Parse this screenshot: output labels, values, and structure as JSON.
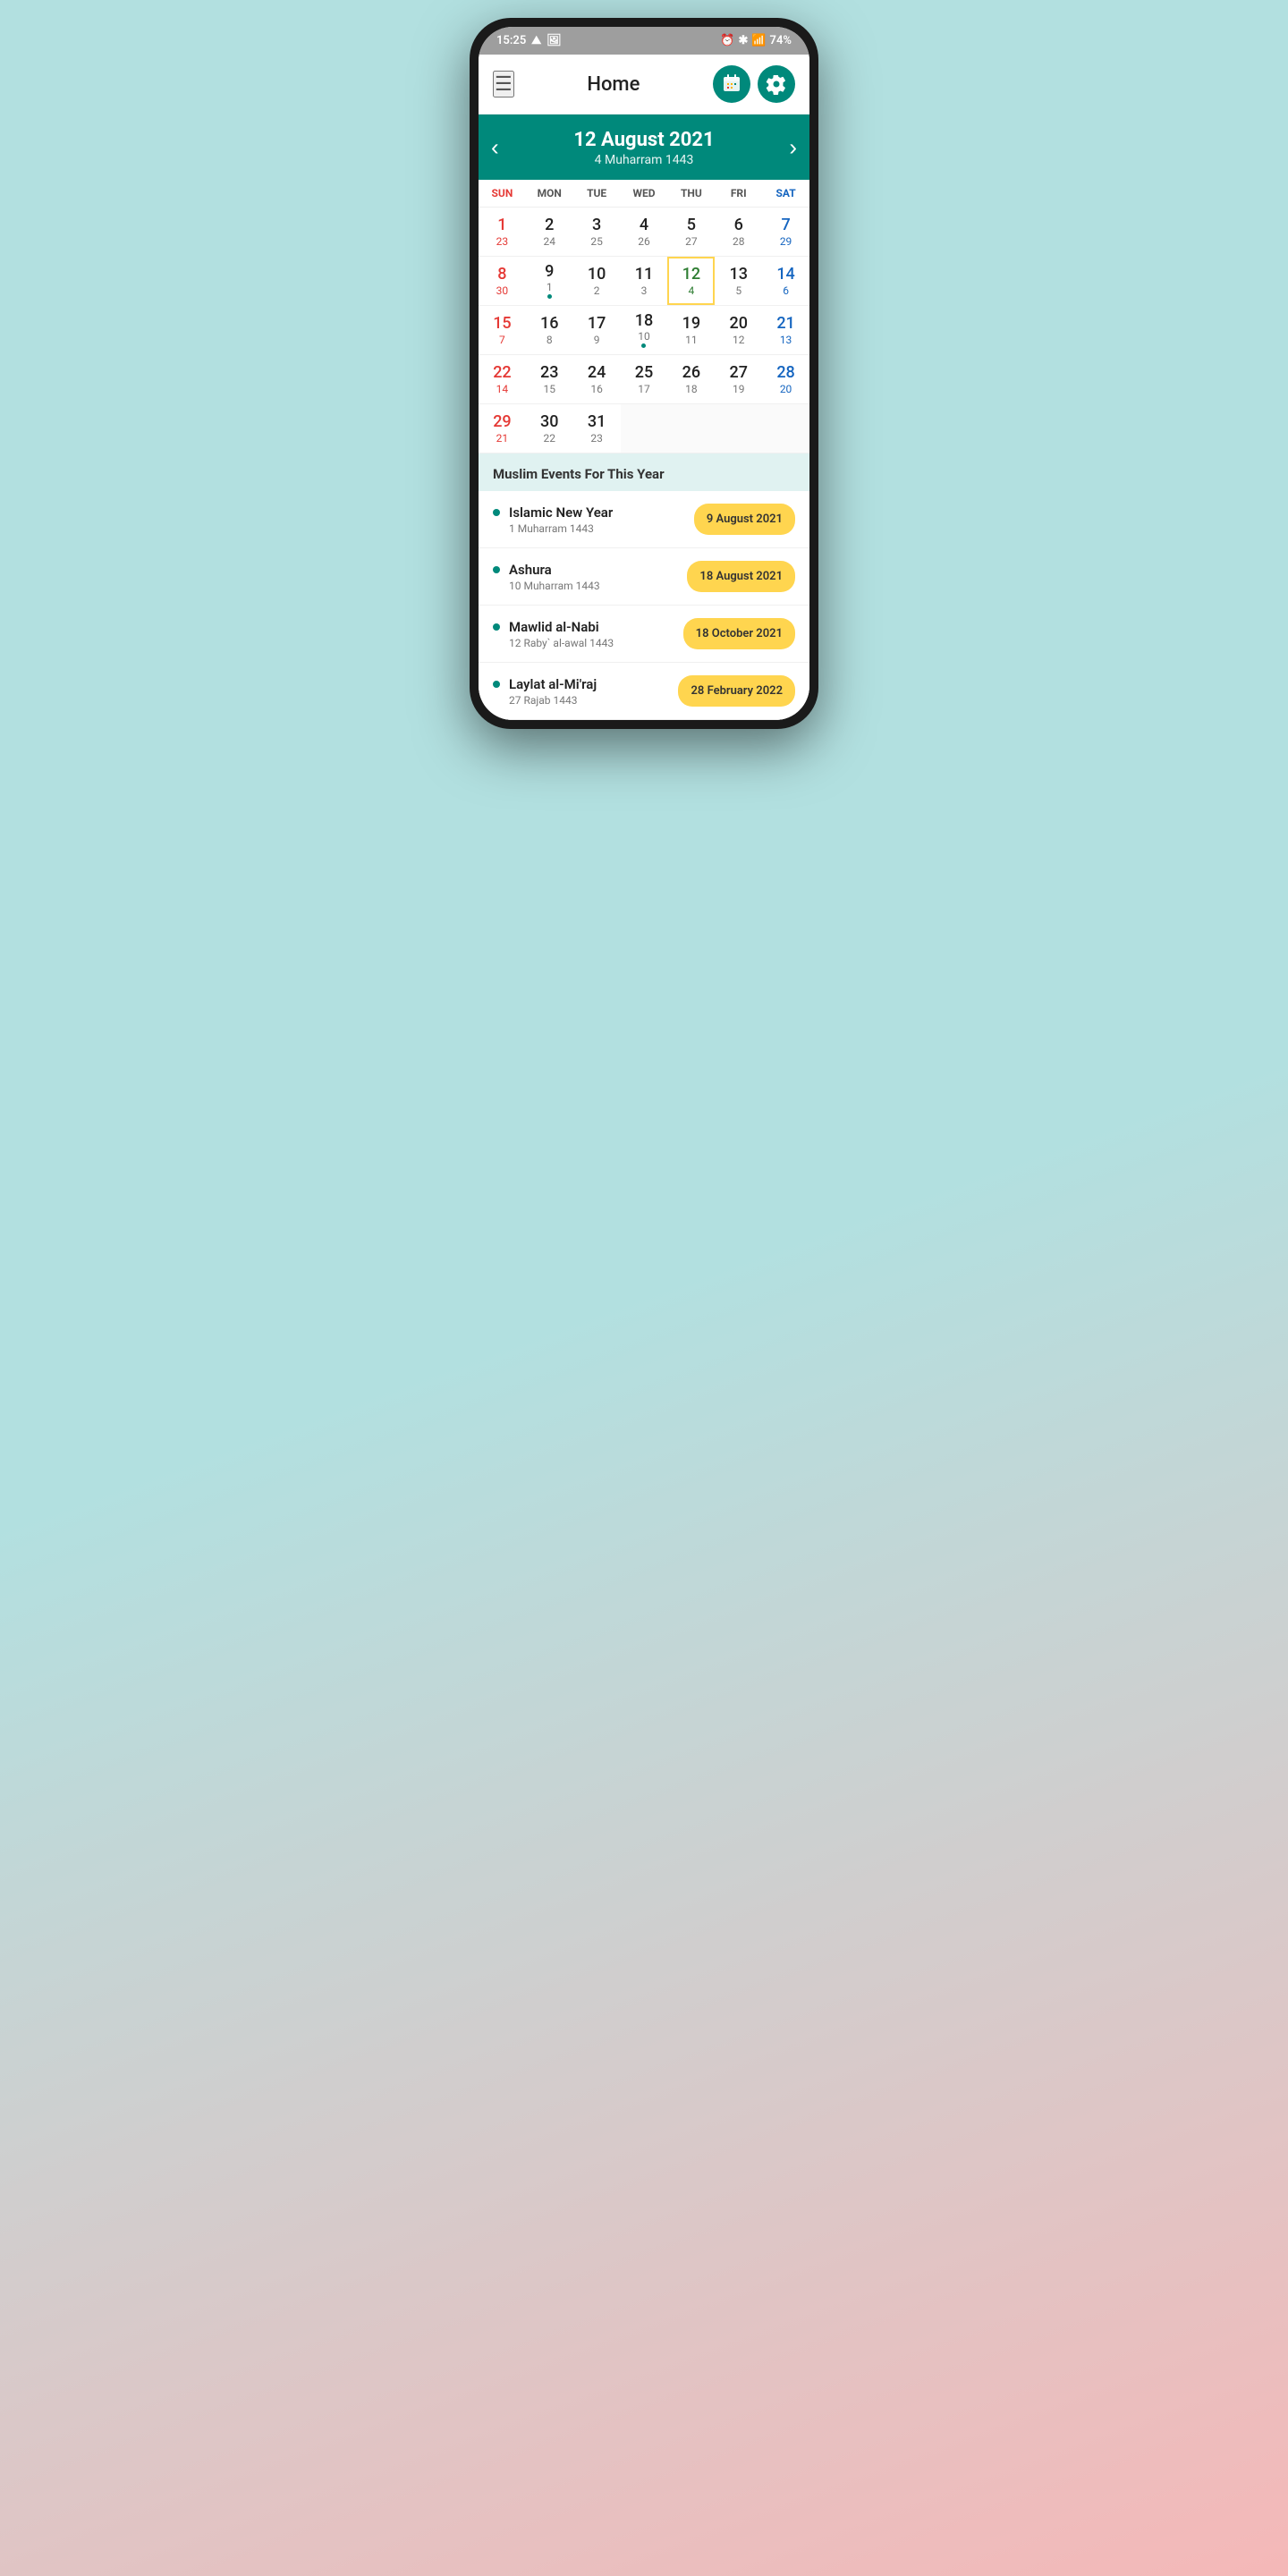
{
  "statusBar": {
    "time": "15:25",
    "battery": "74%"
  },
  "header": {
    "title": "Home"
  },
  "calendar": {
    "monthYear": "12 August 2021",
    "hijriDate": "4 Muharram 1443",
    "dayNames": [
      {
        "label": "SUN",
        "type": "sun"
      },
      {
        "label": "MON",
        "type": "weekday"
      },
      {
        "label": "TUE",
        "type": "weekday"
      },
      {
        "label": "WED",
        "type": "weekday"
      },
      {
        "label": "THU",
        "type": "weekday"
      },
      {
        "label": "FRI",
        "type": "weekday"
      },
      {
        "label": "SAT",
        "type": "sat"
      }
    ],
    "weeks": [
      [
        {
          "greg": "1",
          "hij": "23",
          "type": "sun-day",
          "today": false,
          "dot": false,
          "empty": false
        },
        {
          "greg": "2",
          "hij": "24",
          "type": "weekday-day",
          "today": false,
          "dot": false,
          "empty": false
        },
        {
          "greg": "3",
          "hij": "25",
          "type": "weekday-day",
          "today": false,
          "dot": false,
          "empty": false
        },
        {
          "greg": "4",
          "hij": "26",
          "type": "weekday-day",
          "today": false,
          "dot": false,
          "empty": false
        },
        {
          "greg": "5",
          "hij": "27",
          "type": "weekday-day",
          "today": false,
          "dot": false,
          "empty": false
        },
        {
          "greg": "6",
          "hij": "28",
          "type": "weekday-day",
          "today": false,
          "dot": false,
          "empty": false
        },
        {
          "greg": "7",
          "hij": "29",
          "type": "sat-day",
          "today": false,
          "dot": false,
          "empty": false
        }
      ],
      [
        {
          "greg": "8",
          "hij": "30",
          "type": "sun-day",
          "today": false,
          "dot": false,
          "empty": false
        },
        {
          "greg": "9",
          "hij": "1",
          "type": "weekday-day",
          "today": false,
          "dot": true,
          "empty": false
        },
        {
          "greg": "10",
          "hij": "2",
          "type": "weekday-day",
          "today": false,
          "dot": false,
          "empty": false
        },
        {
          "greg": "11",
          "hij": "3",
          "type": "weekday-day",
          "today": false,
          "dot": false,
          "empty": false
        },
        {
          "greg": "12",
          "hij": "4",
          "type": "weekday-day",
          "today": true,
          "dot": false,
          "empty": false
        },
        {
          "greg": "13",
          "hij": "5",
          "type": "weekday-day",
          "today": false,
          "dot": false,
          "empty": false
        },
        {
          "greg": "14",
          "hij": "6",
          "type": "sat-day",
          "today": false,
          "dot": false,
          "empty": false
        }
      ],
      [
        {
          "greg": "15",
          "hij": "7",
          "type": "sun-day",
          "today": false,
          "dot": false,
          "empty": false
        },
        {
          "greg": "16",
          "hij": "8",
          "type": "weekday-day",
          "today": false,
          "dot": false,
          "empty": false
        },
        {
          "greg": "17",
          "hij": "9",
          "type": "weekday-day",
          "today": false,
          "dot": false,
          "empty": false
        },
        {
          "greg": "18",
          "hij": "10",
          "type": "weekday-day",
          "today": false,
          "dot": true,
          "empty": false
        },
        {
          "greg": "19",
          "hij": "11",
          "type": "weekday-day",
          "today": false,
          "dot": false,
          "empty": false
        },
        {
          "greg": "20",
          "hij": "12",
          "type": "weekday-day",
          "today": false,
          "dot": false,
          "empty": false
        },
        {
          "greg": "21",
          "hij": "13",
          "type": "sat-day",
          "today": false,
          "dot": false,
          "empty": false
        }
      ],
      [
        {
          "greg": "22",
          "hij": "14",
          "type": "sun-day",
          "today": false,
          "dot": false,
          "empty": false
        },
        {
          "greg": "23",
          "hij": "15",
          "type": "weekday-day",
          "today": false,
          "dot": false,
          "empty": false
        },
        {
          "greg": "24",
          "hij": "16",
          "type": "weekday-day",
          "today": false,
          "dot": false,
          "empty": false
        },
        {
          "greg": "25",
          "hij": "17",
          "type": "weekday-day",
          "today": false,
          "dot": false,
          "empty": false
        },
        {
          "greg": "26",
          "hij": "18",
          "type": "weekday-day",
          "today": false,
          "dot": false,
          "empty": false
        },
        {
          "greg": "27",
          "hij": "19",
          "type": "weekday-day",
          "today": false,
          "dot": false,
          "empty": false
        },
        {
          "greg": "28",
          "hij": "20",
          "type": "sat-day",
          "today": false,
          "dot": false,
          "empty": false
        }
      ],
      [
        {
          "greg": "29",
          "hij": "21",
          "type": "sun-day",
          "today": false,
          "dot": false,
          "empty": false
        },
        {
          "greg": "30",
          "hij": "22",
          "type": "weekday-day",
          "today": false,
          "dot": false,
          "empty": false
        },
        {
          "greg": "31",
          "hij": "23",
          "type": "weekday-day",
          "today": false,
          "dot": false,
          "empty": false
        },
        {
          "greg": "",
          "hij": "",
          "type": "empty",
          "today": false,
          "dot": false,
          "empty": true
        },
        {
          "greg": "",
          "hij": "",
          "type": "empty",
          "today": false,
          "dot": false,
          "empty": true
        },
        {
          "greg": "",
          "hij": "",
          "type": "empty",
          "today": false,
          "dot": false,
          "empty": true
        },
        {
          "greg": "",
          "hij": "",
          "type": "empty",
          "today": false,
          "dot": false,
          "empty": true
        }
      ]
    ]
  },
  "events": {
    "sectionTitle": "Muslim Events For This Year",
    "items": [
      {
        "name": "Islamic New Year",
        "hijri": "1 Muharram 1443",
        "date": "9 August 2021"
      },
      {
        "name": "Ashura",
        "hijri": "10 Muharram 1443",
        "date": "18 August 2021"
      },
      {
        "name": "Mawlid al-Nabi",
        "hijri": "12 Raby` al-awal 1443",
        "date": "18 October 2021"
      },
      {
        "name": "Laylat al-Mi'raj",
        "hijri": "27 Rajab 1443",
        "date": "28 February 2022"
      }
    ]
  }
}
